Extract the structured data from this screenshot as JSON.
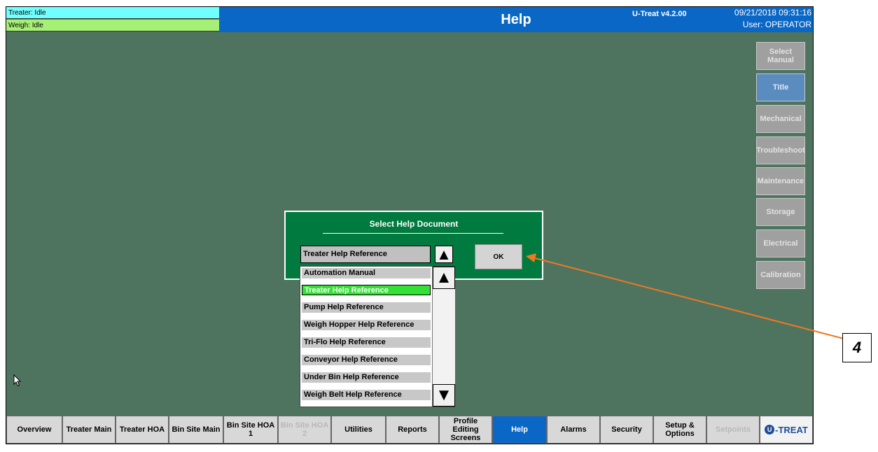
{
  "header": {
    "treater_status": "Treater: Idle",
    "weigh_status": "Weigh: Idle",
    "title": "Help",
    "version": "U-Treat v4.2.00",
    "datetime": "09/21/2018 09:31:16",
    "user": "User: OPERATOR"
  },
  "side_menu": [
    {
      "label": "Select Manual",
      "state": "normal"
    },
    {
      "label": "Title",
      "state": "active"
    },
    {
      "label": "Mechanical",
      "state": "normal"
    },
    {
      "label": "Troubleshoot",
      "state": "normal"
    },
    {
      "label": "Maintenance",
      "state": "normal"
    },
    {
      "label": "Storage",
      "state": "normal"
    },
    {
      "label": "Electrical",
      "state": "normal"
    },
    {
      "label": "Calibration",
      "state": "normal"
    }
  ],
  "dialog": {
    "title": "Select Help Document",
    "selected_value": "Treater Help Reference",
    "ok_label": "OK",
    "options": [
      "Automation Manual",
      "Treater Help Reference",
      "Pump Help Reference",
      "Weigh Hopper Help Reference",
      "Tri-Flo Help Reference",
      "Conveyor Help Reference",
      "Under Bin Help Reference",
      "Weigh Belt Help Reference"
    ],
    "highlighted_index": 1
  },
  "nav": [
    {
      "label": "Overview",
      "state": "normal"
    },
    {
      "label": "Treater Main",
      "state": "normal"
    },
    {
      "label": "Treater HOA",
      "state": "normal"
    },
    {
      "label": "Bin Site Main",
      "state": "normal"
    },
    {
      "label": "Bin Site HOA 1",
      "state": "normal"
    },
    {
      "label": "Bin Site HOA 2",
      "state": "disabled"
    },
    {
      "label": "Utilities",
      "state": "normal"
    },
    {
      "label": "Reports",
      "state": "normal"
    },
    {
      "label": "Profile Editing Screens",
      "state": "normal"
    },
    {
      "label": "Help",
      "state": "active"
    },
    {
      "label": "Alarms",
      "state": "normal"
    },
    {
      "label": "Security",
      "state": "normal"
    },
    {
      "label": "Setup & Options",
      "state": "normal"
    },
    {
      "label": "Setpoints",
      "state": "disabled"
    }
  ],
  "logo_text": "-TREAT",
  "callout_label": "4",
  "colors": {
    "background": "#4e7460",
    "title_bar": "#0a67c6",
    "dialog": "#007a3e",
    "selection": "#33e035",
    "annotation_arrow": "#f07820"
  }
}
